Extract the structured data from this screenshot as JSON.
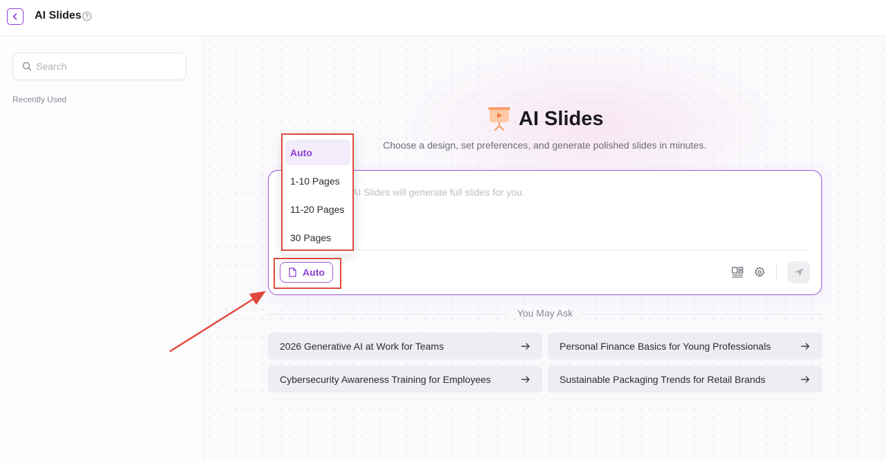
{
  "header": {
    "title": "AI Slides",
    "back_icon": "chevron-left-icon",
    "help_icon": "question-circle-icon",
    "accent_color": "#8b3dd6"
  },
  "sidebar": {
    "search_placeholder": "Search",
    "recently_used_label": "Recently Used"
  },
  "main": {
    "title": "AI Slides",
    "subtitle": "Choose a design, set preferences, and generate polished slides in minutes.",
    "prompt_placeholder": "AI Slides will generate full slides for you.",
    "page_count_button": "Auto",
    "you_may_ask_label": "You May Ask",
    "suggestions": [
      "2026 Generative AI at Work for Teams",
      "Personal Finance Basics for Young Professionals",
      "Cybersecurity Awareness Training for Employees",
      "Sustainable Packaging Trends for Retail Brands"
    ]
  },
  "dropdown": {
    "options": [
      "Auto",
      "1-10 Pages",
      "11-20 Pages",
      "30 Pages"
    ],
    "selected": "Auto"
  },
  "colors": {
    "accent": "#8b3dd6",
    "annotation": "#e0493c"
  }
}
